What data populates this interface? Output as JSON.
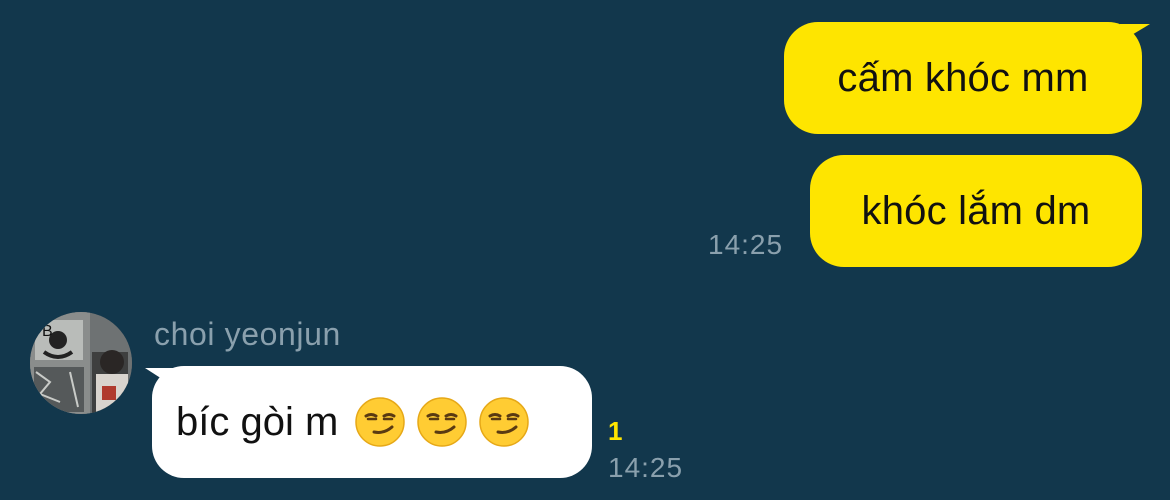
{
  "colors": {
    "background": "#12374c",
    "outgoing_bubble": "#fee500",
    "incoming_bubble": "#ffffff",
    "timestamp": "#8aa0ad",
    "unread_count": "#fee500"
  },
  "outgoing": {
    "messages": [
      {
        "text": "cấm khóc mm"
      },
      {
        "text": "khóc lắm dm"
      }
    ],
    "timestamp": "14:25"
  },
  "incoming": {
    "sender_name": "choi yeonjun",
    "avatar_icon": "avatar-photo",
    "message_text": "bíc gòi m",
    "emojis": [
      "smirking-face-icon",
      "smirking-face-icon",
      "smirking-face-icon"
    ],
    "unread_count": "1",
    "timestamp": "14:25"
  }
}
